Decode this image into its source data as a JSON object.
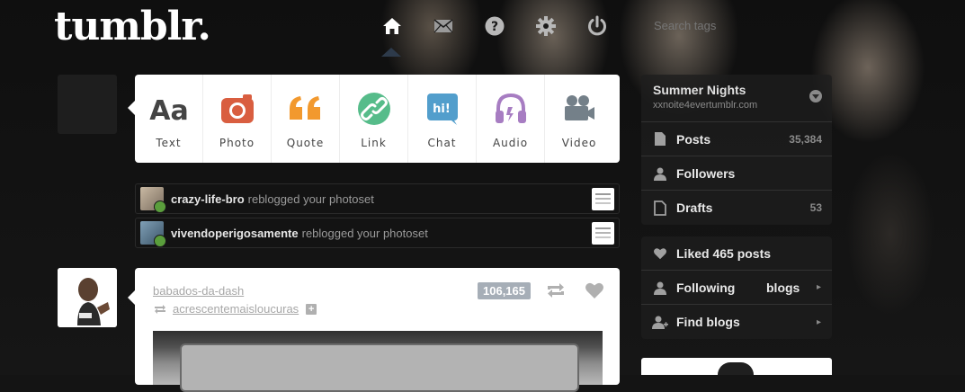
{
  "brand": {
    "logo_text": "tumblr."
  },
  "topnav": {
    "items": [
      {
        "name": "home",
        "icon": "home-icon",
        "active": true
      },
      {
        "name": "messages",
        "icon": "envelope-icon"
      },
      {
        "name": "help",
        "icon": "question-icon"
      },
      {
        "name": "settings",
        "icon": "gear-icon"
      },
      {
        "name": "logout",
        "icon": "power-icon"
      }
    ],
    "search_placeholder": "Search tags"
  },
  "post_types": [
    {
      "label": "Text",
      "icon": "text-icon",
      "color": "#444444"
    },
    {
      "label": "Photo",
      "icon": "camera-icon",
      "color": "#d95e40"
    },
    {
      "label": "Quote",
      "icon": "quote-icon",
      "color": "#f2992e"
    },
    {
      "label": "Link",
      "icon": "link-icon",
      "color": "#56bc8a"
    },
    {
      "label": "Chat",
      "icon": "chat-icon",
      "color": "#529ecc"
    },
    {
      "label": "Audio",
      "icon": "headphones-icon",
      "color": "#a77dc2"
    },
    {
      "label": "Video",
      "icon": "video-camera-icon",
      "color": "#748089"
    }
  ],
  "notifications": [
    {
      "user": "crazy-life-bro",
      "action": "reblogged your photoset"
    },
    {
      "user": "vivendoperigosamente",
      "action": "reblogged your photoset"
    }
  ],
  "post": {
    "author": "babados-da-dash",
    "reblogged_from": "acrescentemaisloucuras",
    "notes": "106,165"
  },
  "sidebar": {
    "blog": {
      "title": "Summer Nights",
      "url": "xxnoite4evertumblr.com"
    },
    "stats": [
      {
        "label": "Posts",
        "count": "35,384",
        "icon": "document-icon"
      },
      {
        "label": "Followers",
        "count": "",
        "icon": "followers-icon"
      },
      {
        "label": "Drafts",
        "count": "53",
        "icon": "draft-icon"
      }
    ],
    "links": {
      "liked": "Liked 465 posts",
      "following": "Following",
      "following_blogs": "blogs",
      "find_blogs": "Find blogs"
    }
  },
  "colors": {
    "accent_nav": "#2d3a4a",
    "notes_badge": "#a6aeb7"
  }
}
